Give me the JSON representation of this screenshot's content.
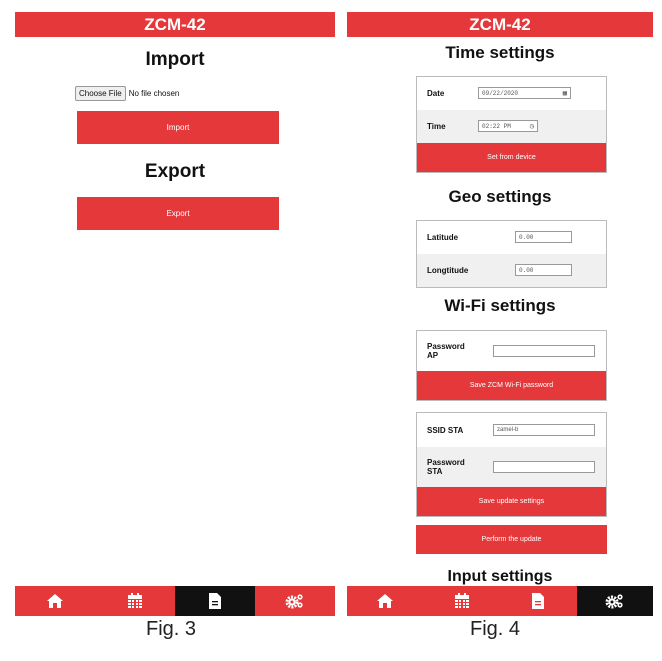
{
  "fig3": {
    "app_title": "ZCM-42",
    "import_heading": "Import",
    "choose_file_label": "Choose File",
    "no_file_text": "No file chosen",
    "import_button": "Import",
    "export_heading": "Export",
    "export_button": "Export",
    "active_tab": "documents",
    "caption": "Fig. 3"
  },
  "fig4": {
    "app_title": "ZCM-42",
    "time": {
      "heading": "Time settings",
      "date_label": "Date",
      "date_value": "09/22/2020",
      "time_label": "Time",
      "time_value": "02:22 PM",
      "set_from_device_button": "Set from device"
    },
    "geo": {
      "heading": "Geo settings",
      "latitude_label": "Latitude",
      "latitude_value": "0.00",
      "longitude_label": "Longtitude",
      "longitude_value": "0.00"
    },
    "wifi": {
      "heading": "Wi-Fi settings",
      "password_ap_label": "Password AP",
      "password_ap_value": "",
      "save_password_button": "Save ZCM Wi-Fi password",
      "ssid_sta_label": "SSID STA",
      "ssid_sta_value": "zamel-b",
      "password_sta_label": "Password STA",
      "password_sta_value": "",
      "save_update_button": "Save update settings",
      "perform_update_button": "Perform the update"
    },
    "input": {
      "heading": "Input settings"
    },
    "active_tab": "settings",
    "caption": "Fig. 4"
  },
  "nav_icons": [
    "home-icon",
    "calendar-icon",
    "document-icon",
    "gears-icon"
  ],
  "colors": {
    "accent": "#e5383b",
    "active_tab": "#111111",
    "row_shade": "#f0f0f0"
  }
}
